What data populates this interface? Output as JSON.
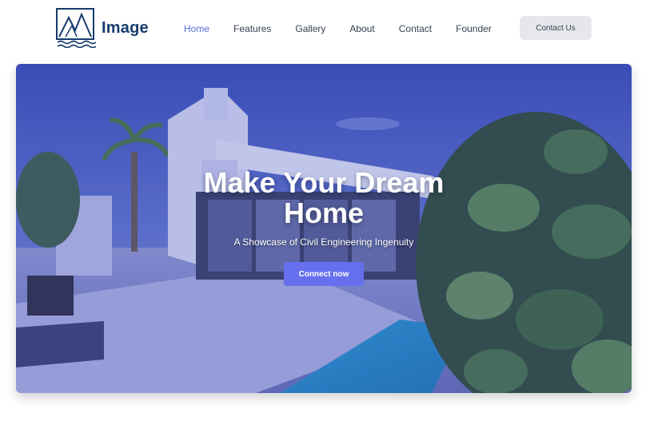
{
  "brand": {
    "name": "Image",
    "logo_icon": "mountain-logo-icon"
  },
  "nav": {
    "items": [
      {
        "label": "Home",
        "active": true
      },
      {
        "label": "Features",
        "active": false
      },
      {
        "label": "Gallery",
        "active": false
      },
      {
        "label": "About",
        "active": false
      },
      {
        "label": "Contact",
        "active": false
      },
      {
        "label": "Founder",
        "active": false
      }
    ],
    "cta_label": "Contact Us"
  },
  "hero": {
    "title": "Make Your Dream Home",
    "subtitle": "A Showcase of Civil Engineering Ingenuity",
    "button_label": "Connect now"
  },
  "colors": {
    "brand_text": "#173b6c",
    "nav_active": "#5b6fd6",
    "primary_button": "#6670ee",
    "secondary_button": "#e5e7eb"
  }
}
